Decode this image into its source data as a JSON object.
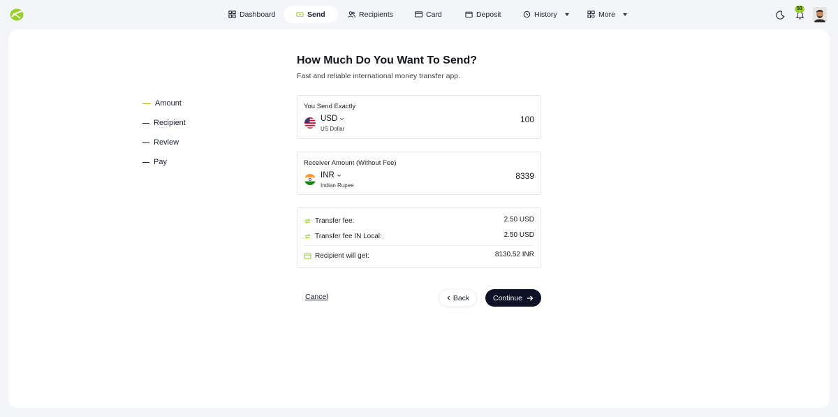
{
  "nav": {
    "items": [
      {
        "label": "Dashboard",
        "icon": "grid-icon"
      },
      {
        "label": "Send",
        "icon": "money-icon",
        "active": true
      },
      {
        "label": "Recipients",
        "icon": "users-icon"
      },
      {
        "label": "Card",
        "icon": "card-icon"
      },
      {
        "label": "Deposit",
        "icon": "wallet-icon"
      },
      {
        "label": "History",
        "icon": "history-icon",
        "dropdown": true
      },
      {
        "label": "More",
        "icon": "apps-icon",
        "dropdown": true
      }
    ],
    "notification_count": "50"
  },
  "steps": [
    {
      "label": "Amount",
      "active": true
    },
    {
      "label": "Recipient"
    },
    {
      "label": "Review"
    },
    {
      "label": "Pay"
    }
  ],
  "page": {
    "title": "How Much Do You Want To Send?",
    "subtitle": "Fast and reliable international money transfer app."
  },
  "send": {
    "label": "You Send Exactly",
    "currency_code": "USD",
    "currency_name": "US Dollar",
    "amount": "100"
  },
  "receive": {
    "label": "Receiver Amount (Without Fee)",
    "currency_code": "INR",
    "currency_name": "Indian Rupee",
    "amount": "8339"
  },
  "fees": {
    "transfer_fee_label": "Transfer fee:",
    "transfer_fee_value": "2.50 USD",
    "transfer_fee_local_label": "Transfer fee IN Local:",
    "transfer_fee_local_value": "2.50 USD",
    "recipient_gets_label": "Recipient will get:",
    "recipient_gets_value": "8130.52 INR"
  },
  "actions": {
    "cancel": "Cancel",
    "back": "Back",
    "continue": "Continue"
  },
  "colors": {
    "accent": "#9ccf2a",
    "primary_button": "#0d1226",
    "background": "#f3f5f8"
  }
}
